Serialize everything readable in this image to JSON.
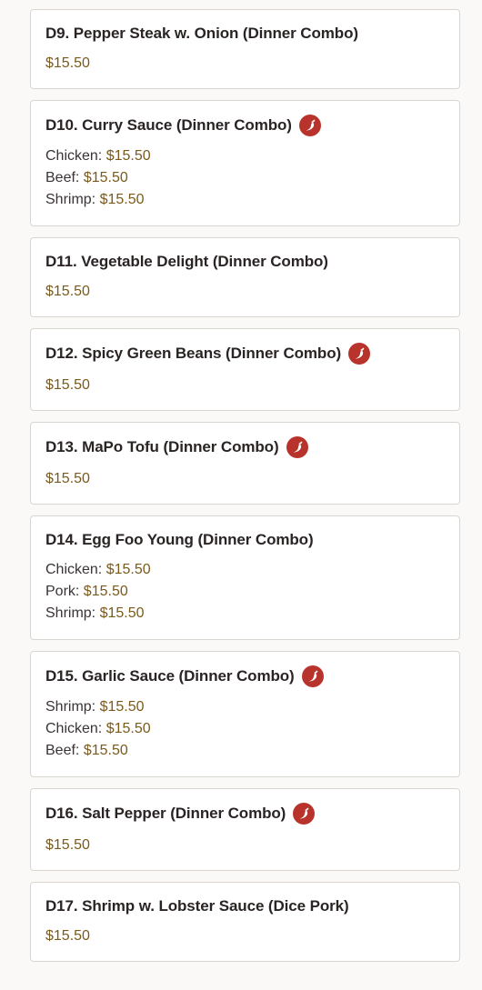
{
  "colors": {
    "background": "#faf9f7",
    "card_border": "#d9d6d2",
    "title": "#2a2424",
    "price": "#7a5a1c",
    "spicy_badge": "#b8332c"
  },
  "items": [
    {
      "title": "D9. Pepper Steak w. Onion (Dinner Combo)",
      "spicy": false,
      "price": "$15.50"
    },
    {
      "title": "D10. Curry Sauce (Dinner Combo)",
      "spicy": true,
      "options": [
        {
          "label": "Chicken:",
          "price": "$15.50"
        },
        {
          "label": "Beef:",
          "price": "$15.50"
        },
        {
          "label": "Shrimp:",
          "price": "$15.50"
        }
      ]
    },
    {
      "title": "D11. Vegetable Delight (Dinner Combo)",
      "spicy": false,
      "price": "$15.50"
    },
    {
      "title": "D12. Spicy Green Beans (Dinner Combo)",
      "spicy": true,
      "price": "$15.50"
    },
    {
      "title": "D13. MaPo Tofu (Dinner Combo)",
      "spicy": true,
      "price": "$15.50"
    },
    {
      "title": "D14. Egg Foo Young (Dinner Combo)",
      "spicy": false,
      "options": [
        {
          "label": "Chicken:",
          "price": "$15.50"
        },
        {
          "label": "Pork:",
          "price": "$15.50"
        },
        {
          "label": "Shrimp:",
          "price": "$15.50"
        }
      ]
    },
    {
      "title": "D15. Garlic Sauce (Dinner Combo)",
      "spicy": true,
      "options": [
        {
          "label": "Shrimp:",
          "price": "$15.50"
        },
        {
          "label": "Chicken:",
          "price": "$15.50"
        },
        {
          "label": "Beef:",
          "price": "$15.50"
        }
      ]
    },
    {
      "title": "D16. Salt Pepper (Dinner Combo)",
      "spicy": true,
      "price": "$15.50"
    },
    {
      "title": "D17. Shrimp w. Lobster Sauce (Dice Pork)",
      "spicy": false,
      "price": "$15.50"
    }
  ]
}
